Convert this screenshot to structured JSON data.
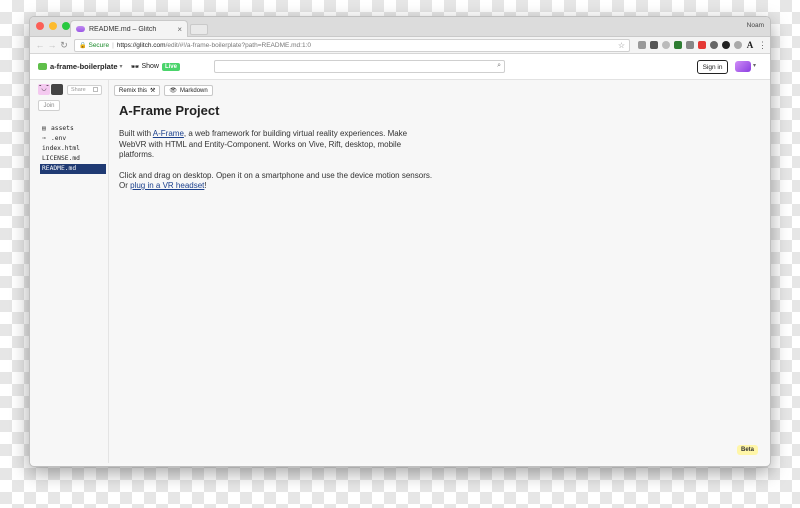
{
  "browser": {
    "tab_title": "README.md – Glitch",
    "tab_close": "×",
    "user_name": "Noam",
    "security_label": "Secure",
    "url_host": "https://glitch.com",
    "url_rest": "/edit/#!/a-frame-boilerplate?path=README.md:1:0",
    "icons": [
      "back-icon",
      "forward-icon",
      "reload-icon",
      "lock-icon",
      "star-icon",
      "menu-icon"
    ]
  },
  "header": {
    "project_name": "a-frame-boilerplate",
    "show_label": "Show",
    "live_badge": "Live",
    "search_placeholder": "",
    "sign_in_label": "Sign in"
  },
  "sidebar": {
    "share_label": "Share",
    "join_label": "Join",
    "files": [
      {
        "name": "assets",
        "icon": "folder-icon"
      },
      {
        "name": ".env",
        "icon": "key-icon"
      },
      {
        "name": "index.html"
      },
      {
        "name": "LICENSE.md"
      },
      {
        "name": "README.md",
        "active": true
      }
    ]
  },
  "toolbar": {
    "remix_label": "Remix this",
    "markdown_label": "Markdown"
  },
  "document": {
    "title": "A-Frame Project",
    "p1_before": "Built with ",
    "p1_link": "A-Frame",
    "p1_after": ", a web framework for building virtual reality experiences. Make WebVR with HTML and Entity-Component. Works on Vive, Rift, desktop, mobile platforms.",
    "p2_before": "Click and drag on desktop. Open it on a smartphone and use the device motion sensors. Or ",
    "p2_link": "plug in a VR headset",
    "p2_after": "!"
  },
  "beta_label": "Beta",
  "colors": {
    "live_green": "#4ad46b",
    "active_file_bg": "#1f3a73",
    "link": "#1a3f8c",
    "beta_bg": "#fff6a8"
  }
}
